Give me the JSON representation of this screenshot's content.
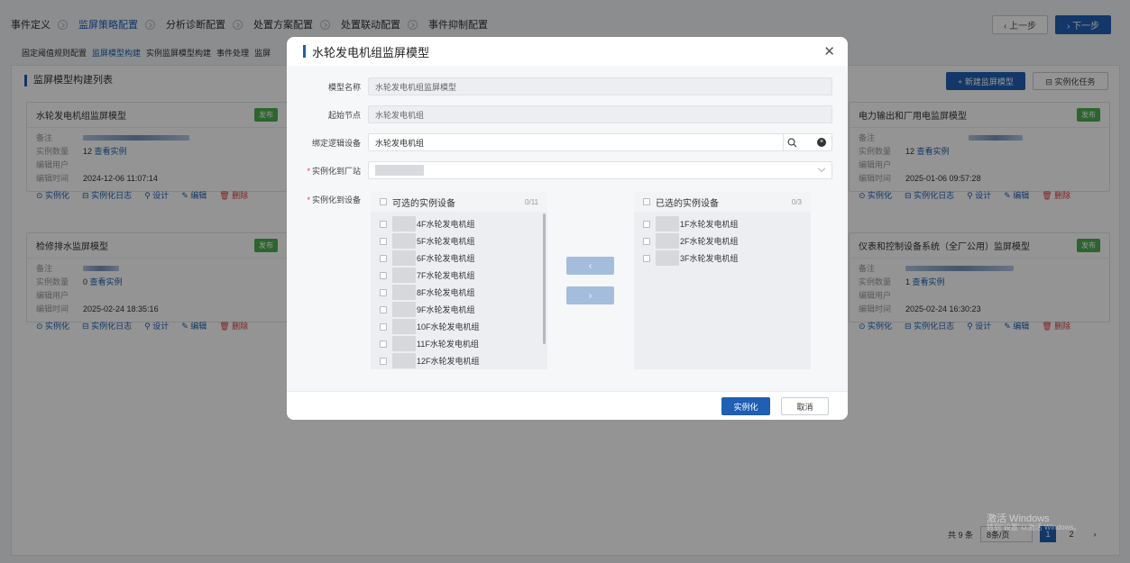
{
  "steps": [
    "事件定义",
    "监屏策略配置",
    "分析诊断配置",
    "处置方案配置",
    "处置联动配置",
    "事件抑制配置"
  ],
  "prev_label": "‹ 上一步",
  "next_label": "› 下一步",
  "subtabs": [
    "固定阈值规则配置",
    "监屏模型构建",
    "实例监屏模型构建",
    "事件处理",
    "监屏"
  ],
  "panel_title": "监屏模型构建列表",
  "new_button": "+ 新建监屏模型",
  "task_button": "⊟ 实例化任务",
  "labels": {
    "note": "备注",
    "count": "实例数量",
    "user": "编辑用户",
    "time": "编辑时间",
    "view": "查看实例"
  },
  "badge": "发布",
  "actions": [
    "⊙ 实例化",
    "⊟ 实例化日志",
    "⚲ 设计",
    "✎ 编辑",
    "🗑 删除"
  ],
  "cards": [
    {
      "title": "水轮发电机组监屏模型",
      "count": "12",
      "time": "2024-12-06 11:07:14"
    },
    {
      "title": "电力输出和厂用电监屏模型",
      "count": "12",
      "time": "2025-01-06 09:57:28"
    },
    {
      "title": "检修排水监屏模型",
      "count": "0",
      "time": "2025-02-24 18:35:16"
    },
    {
      "title": "仪表和控制设备系统（全厂公用）监屏模型",
      "count": "1",
      "time": "2025-02-24 16:30:23"
    }
  ],
  "pager": {
    "total": "共 9 条",
    "size": "8条/页",
    "page1": "1",
    "page2": "2",
    "next": "›"
  },
  "watermark": {
    "line1": "激活 Windows",
    "line2": "转到\"设置\"以激活 Windows。"
  },
  "modal": {
    "title": "水轮发电机组监屏模型",
    "close": "✕",
    "fields": {
      "model_name_label": "模型名称",
      "model_name": "水轮发电机组监屏模型",
      "start_node_label": "起始节点",
      "start_node": "水轮发电机组",
      "device_label": "绑定逻辑设备",
      "device": "水轮发电机组",
      "station_label": "实例化到厂站",
      "inst_device_label": "实例化到设备"
    },
    "left_title": "可选的实例设备",
    "left_count": "0/11",
    "left_items": [
      "4F水轮发电机组",
      "5F水轮发电机组",
      "6F水轮发电机组",
      "7F水轮发电机组",
      "8F水轮发电机组",
      "9F水轮发电机组",
      "10F水轮发电机组",
      "11F水轮发电机组",
      "12F水轮发电机组"
    ],
    "right_title": "已选的实例设备",
    "right_count": "0/3",
    "right_items": [
      "1F水轮发电机组",
      "2F水轮发电机组",
      "3F水轮发电机组"
    ],
    "arrow_left": "‹",
    "arrow_right": "›",
    "ok": "实例化",
    "cancel": "取消"
  }
}
